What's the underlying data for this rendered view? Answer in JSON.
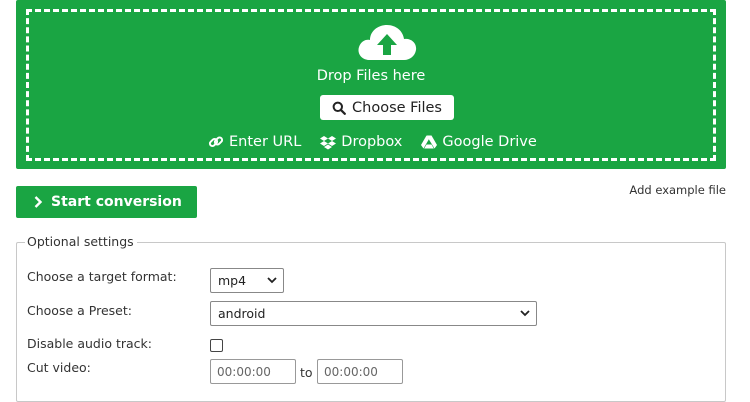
{
  "upload": {
    "drop_text": "Drop Files here",
    "choose_files_label": "Choose Files",
    "sources": [
      {
        "icon": "link-icon",
        "label": "Enter URL"
      },
      {
        "icon": "dropbox-icon",
        "label": "Dropbox"
      },
      {
        "icon": "google-drive-icon",
        "label": "Google Drive"
      }
    ],
    "color": "#1aa543"
  },
  "actions": {
    "start_label": "Start conversion",
    "example_label": "Add example file"
  },
  "settings": {
    "legend": "Optional settings",
    "target_format_label": "Choose a target format:",
    "target_format_value": "mp4",
    "preset_label": "Choose a Preset:",
    "preset_value": "android",
    "disable_audio_label": "Disable audio track:",
    "disable_audio_checked": false,
    "cut_video_label": "Cut video:",
    "cut_start_placeholder": "00:00:00",
    "cut_to_label": "to",
    "cut_end_placeholder": "00:00:00"
  }
}
